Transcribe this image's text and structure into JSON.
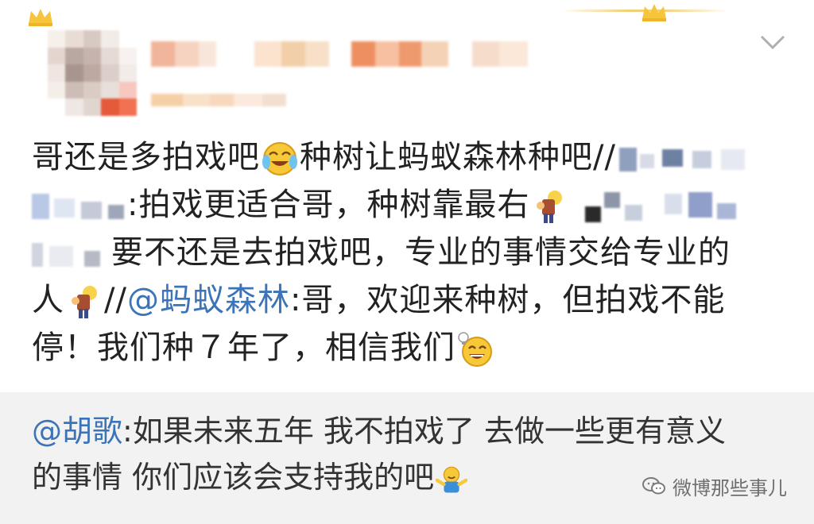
{
  "post": {
    "line1_text": "哥还是多拍戏吧",
    "line1_text2": "种树让蚂蚁森林种吧//",
    "line2_text": ":拍戏更适合哥，种树靠最右",
    "line3_text": "要不还是去拍戏吧，专业的事情交给专业的",
    "line4_text_a": "人",
    "line4_slashes": "//",
    "line4_mention": "@蚂蚁森林",
    "line4_text_b": ":哥，欢迎来种树，但拍戏不能",
    "line5_text": "停！我们种７年了，相信我们"
  },
  "quote": {
    "mention": "@胡歌",
    "line1_text": ":如果未来五年 我不拍戏了 去做一些更有意义",
    "line2_text": "的事情 你们应该会支持我的吧"
  },
  "watermark": {
    "text": "微博那些事儿"
  },
  "icons": {
    "emoji_1": "laugh-cry-emoji-icon",
    "emoji_2": "rightmost-guy-emoji-icon",
    "emoji_3": "smile-lightbulb-emoji-icon",
    "emoji_4": "shrug-emoji-icon",
    "chevron": "chevron-down-icon",
    "crown": "crown-icon"
  },
  "colors": {
    "mention": "#3b74b8",
    "text": "#222222",
    "quote_bg": "#f2f2f2"
  }
}
